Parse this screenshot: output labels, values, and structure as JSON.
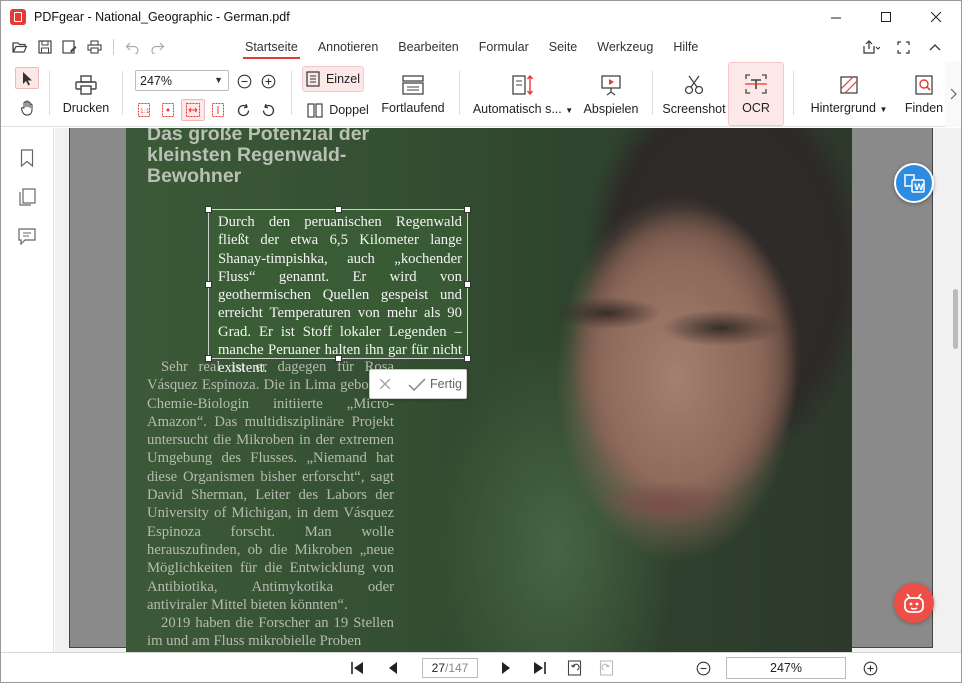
{
  "window": {
    "title": "PDFgear - National_Geographic - German.pdf"
  },
  "menu": {
    "tabs": [
      "Startseite",
      "Annotieren",
      "Bearbeiten",
      "Formular",
      "Seite",
      "Werkzeug",
      "Hilfe"
    ],
    "active_tab": "Startseite"
  },
  "ribbon": {
    "print": "Drucken",
    "zoom": "247%",
    "single": "Einzel",
    "double": "Doppel",
    "continuous": "Fortlaufend",
    "auto_scroll": "Automatisch s...",
    "play": "Abspielen",
    "screenshot": "Screenshot",
    "ocr": "OCR",
    "background": "Hintergrund",
    "find": "Finden"
  },
  "document": {
    "headline": "Das große Potenzial der kleinsten Regenwald-Bewohner",
    "selected_text": "Durch den peruanischen Regenwald fließt der etwa 6,5 Kilometer lange Shanay-timpishka, auch „kochender Fluss“ genannt. Er wird von geothermischen Quellen gespeist und erreicht Temperaturen von mehr als 90 Grad. Er ist Stoff lokaler Legenden – manche Peruaner halten ihn gar für nicht existent.",
    "paragraph_2": "Sehr real ist er dagegen für Rosa Vásquez Espinoza. Die in Lima geborene Chemie-Biologin initiierte „Micro-Amazon“. Das multidisziplinäre Projekt untersucht die Mikroben in der extremen Umgebung des Flusses. „Niemand hat diese Organismen bisher erforscht“, sagt David Sherman, Leiter des Labors der University of Michigan, in dem Vásquez Espinoza forscht. Man wolle herauszufinden, ob die Mikroben „neue Möglichkeiten für die Entwicklung von Antibiotika, Antimykotika oder antiviraler Mittel bieten könnten“.",
    "paragraph_3": "2019 haben die Forscher an 19 Stellen im und am Fluss mikrobielle Proben"
  },
  "ocr_popup": {
    "done": "Fertig"
  },
  "status": {
    "current_page": "27",
    "total_pages": "/147",
    "zoom": "247%"
  }
}
